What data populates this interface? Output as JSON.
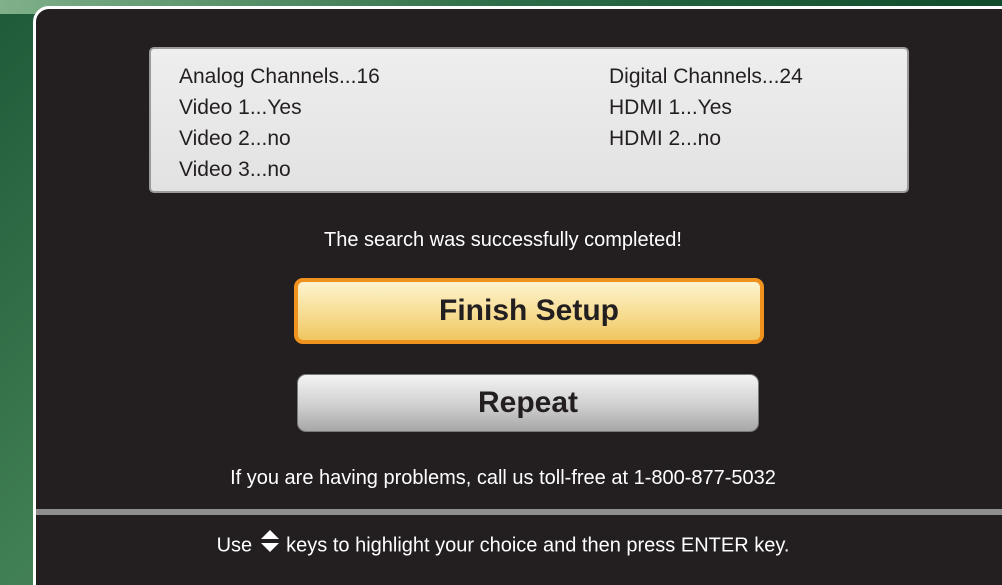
{
  "status": {
    "left": [
      "Analog Channels...16",
      "Video 1...Yes",
      "Video 2...no",
      "Video 3...no"
    ],
    "right": [
      "Digital Channels...24",
      "HDMI 1...Yes",
      "HDMI 2...no"
    ]
  },
  "message": "The search was successfully completed!",
  "buttons": {
    "finish": "Finish Setup",
    "repeat": "Repeat"
  },
  "help": "If you are having problems, call us toll-free at 1-800-877-5032",
  "hint": {
    "before": "Use",
    "after": "keys to highlight your choice and then press ENTER key.",
    "icon": "up-down-arrow-icon"
  },
  "colors": {
    "panel": "#231f20",
    "highlight_border": "#f0921e",
    "background": "#3f7d52"
  }
}
